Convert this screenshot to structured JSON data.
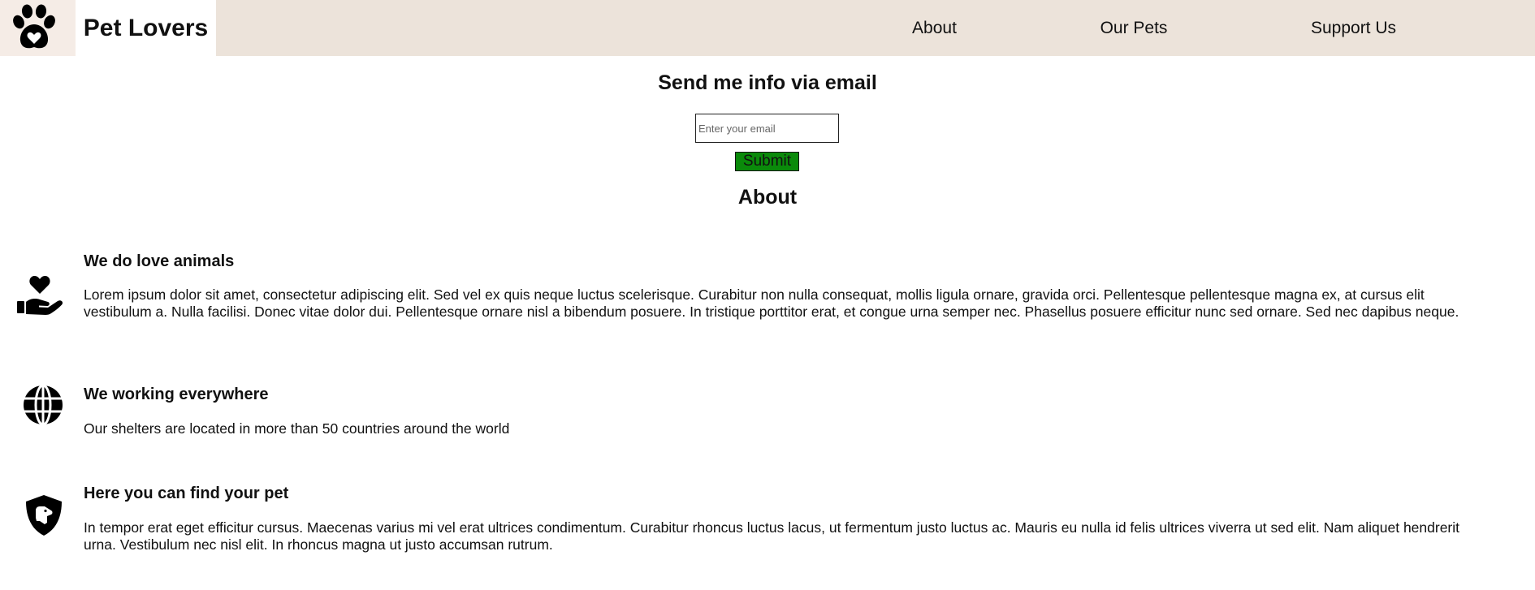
{
  "header": {
    "logo_icon": "paw-heart-icon",
    "brand": "Pet Lovers",
    "bg_color": "#ece3da",
    "nav": [
      {
        "label": "About"
      },
      {
        "label": "Our Pets"
      },
      {
        "label": "Support Us"
      }
    ]
  },
  "email_form": {
    "title": "Send me info via email",
    "input_placeholder": "Enter your email",
    "input_value": "",
    "submit_label": "Submit",
    "submit_color": "#0a8a0a"
  },
  "about": {
    "title": "About",
    "features": [
      {
        "icon": "hand-heart-icon",
        "title": "We do love animals",
        "text": "Lorem ipsum dolor sit amet, consectetur adipiscing elit. Sed vel ex quis neque luctus scelerisque. Curabitur non nulla consequat, mollis ligula ornare, gravida orci. Pellentesque pellentesque magna ex, at cursus elit vestibulum a. Nulla facilisi. Donec vitae dolor dui. Pellentesque ornare nisl a bibendum posuere. In tristique porttitor erat, et congue urna semper nec. Phasellus posuere efficitur nunc sed ornare. Sed nec dapibus neque."
      },
      {
        "icon": "globe-icon",
        "title": "We working everywhere",
        "text": "Our shelters are located in more than 50 countries around the world"
      },
      {
        "icon": "shield-dog-icon",
        "title": "Here you can find your pet",
        "text": "In tempor erat eget efficitur cursus. Maecenas varius mi vel erat ultrices condimentum. Curabitur rhoncus luctus lacus, ut fermentum justo luctus ac. Mauris eu nulla id felis ultrices viverra ut sed elit. Nam aliquet hendrerit urna. Vestibulum nec nisl elit. In rhoncus magna ut justo accumsan rutrum."
      }
    ]
  }
}
